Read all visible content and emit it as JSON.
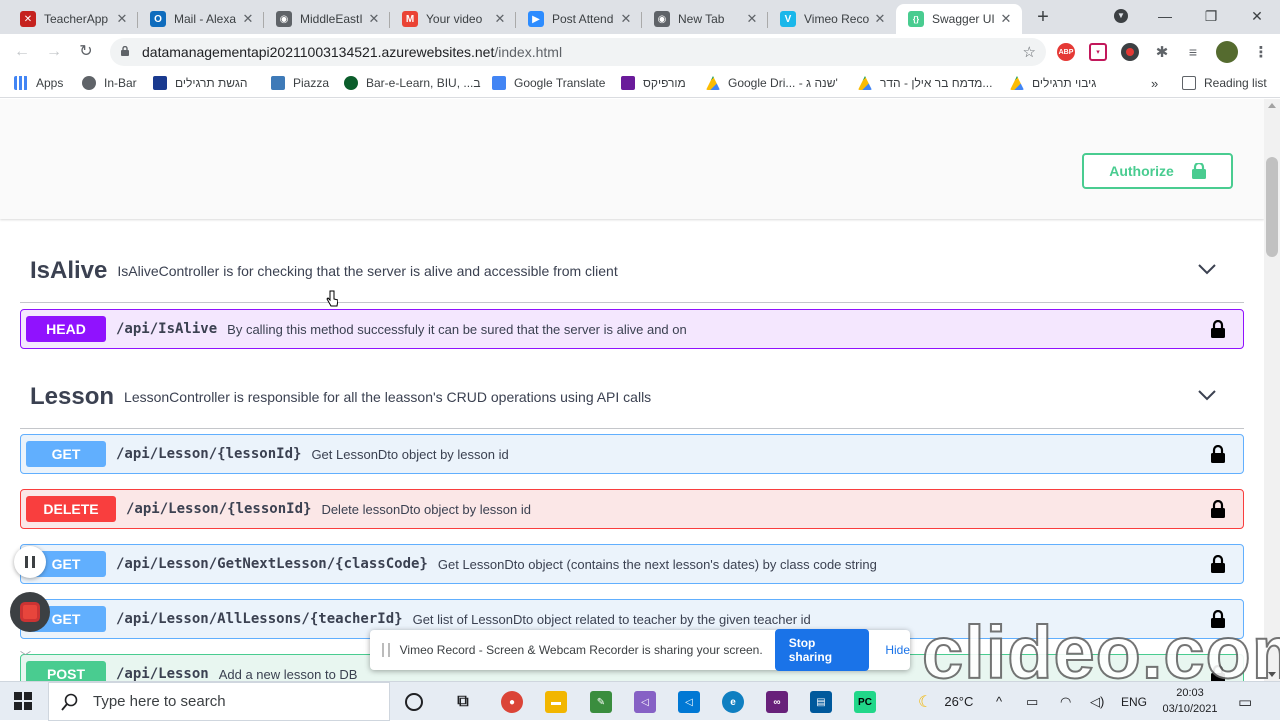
{
  "browser": {
    "tabs": [
      {
        "label": "TeacherApp",
        "color": "#c5221f",
        "glyph": "✕"
      },
      {
        "label": "Mail - Alexa",
        "color": "#0f6cbd",
        "glyph": "O"
      },
      {
        "label": "MiddleEastI",
        "color": "#5f6368",
        "glyph": "◉"
      },
      {
        "label": "Your video",
        "color": "#ea4335",
        "glyph": "M"
      },
      {
        "label": "Post Attend",
        "color": "#2d8cff",
        "glyph": "▶"
      },
      {
        "label": "New Tab",
        "color": "#5f6368",
        "glyph": "◉"
      },
      {
        "label": "Vimeo Reco",
        "color": "#1ab7ea",
        "glyph": "V"
      },
      {
        "label": "Swagger UI",
        "color": "#49cc90",
        "glyph": "{}"
      }
    ],
    "url_host": "datamanagementapi20211003134521.azurewebsites.net",
    "url_path": "/index.html",
    "bookmarks": [
      {
        "label": "Apps",
        "color": "#4285f4"
      },
      {
        "label": "In-Bar",
        "color": "#5f6368"
      },
      {
        "label": "הגשת תרגילים",
        "color": "#1a3a8f"
      },
      {
        "label": "Piazza",
        "color": "#3e7ab8"
      },
      {
        "label": "Bar-e-Learn, BIU, ...ב",
        "color": "#0b5d2b"
      },
      {
        "label": "Google Translate",
        "color": "#4285f4"
      },
      {
        "label": "מורפיקס",
        "color": "#6a1b9a"
      },
      {
        "label": "Google Dri... - שנה ג'",
        "color": "#fbbc04"
      },
      {
        "label": "מדמח בר אילן - הדר...",
        "color": "#fbbc04"
      },
      {
        "label": "גיבוי תרגילים",
        "color": "#fbbc04"
      }
    ],
    "more_bookmarks": "»",
    "reading_list": "Reading list"
  },
  "swagger": {
    "authorize_label": "Authorize",
    "accent": "#49cc90",
    "tags": [
      {
        "name": "IsAlive",
        "description": "IsAliveController is for checking that the server is alive and accessible from client"
      },
      {
        "name": "Lesson",
        "description": "LessonController is responsible for all the leasson's CRUD operations using API calls"
      }
    ],
    "operations": [
      {
        "method": "HEAD",
        "path": "/api/IsAlive",
        "description": "By calling this method successfuly it can be sured that the server is alive and on",
        "badge_color": "#9012fe",
        "bg_color": "#f4e7fe"
      },
      {
        "method": "GET",
        "path": "/api/Lesson/{lessonId}",
        "description": "Get LessonDto object by lesson id",
        "badge_color": "#61affe",
        "bg_color": "#ebf3fb"
      },
      {
        "method": "DELETE",
        "path": "/api/Lesson/{lessonId}",
        "description": "Delete lessonDto object by lesson id",
        "badge_color": "#f93e3e",
        "bg_color": "#fbe7e7"
      },
      {
        "method": "GET",
        "path": "/api/Lesson/GetNextLesson/{classCode}",
        "description": "Get LessonDto object (contains the next lesson's dates) by class code string",
        "badge_color": "#61affe",
        "bg_color": "#ebf3fb"
      },
      {
        "method": "GET",
        "path": "/api/Lesson/AllLessons/{teacherId}",
        "description": "Get list of LessonDto object related to teacher by the given teacher id",
        "badge_color": "#61affe",
        "bg_color": "#ebf3fb"
      },
      {
        "method": "POST",
        "path": "/api/Lesson",
        "description": "Add a new lesson to DB",
        "badge_color": "#49cc90",
        "bg_color": "#e8f6f0"
      }
    ]
  },
  "share_bar": {
    "text": "Vimeo Record - Screen & Webcam Recorder is sharing your screen.",
    "stop_label": "Stop sharing",
    "hide_label": "Hide"
  },
  "watermark": "clideo.com",
  "taskbar": {
    "search_placeholder": "Type here to search",
    "weather": "26°C",
    "language": "ENG",
    "time": "20:03",
    "date": "03/10/2021"
  }
}
